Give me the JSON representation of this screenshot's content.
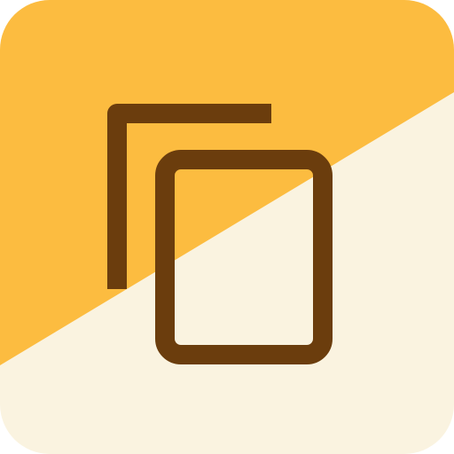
{
  "icon": {
    "name": "copy-icon",
    "colors": {
      "background_top": "#FCBC40",
      "background_bottom": "#FAF3E0",
      "stroke": "#6B3D0D"
    }
  }
}
